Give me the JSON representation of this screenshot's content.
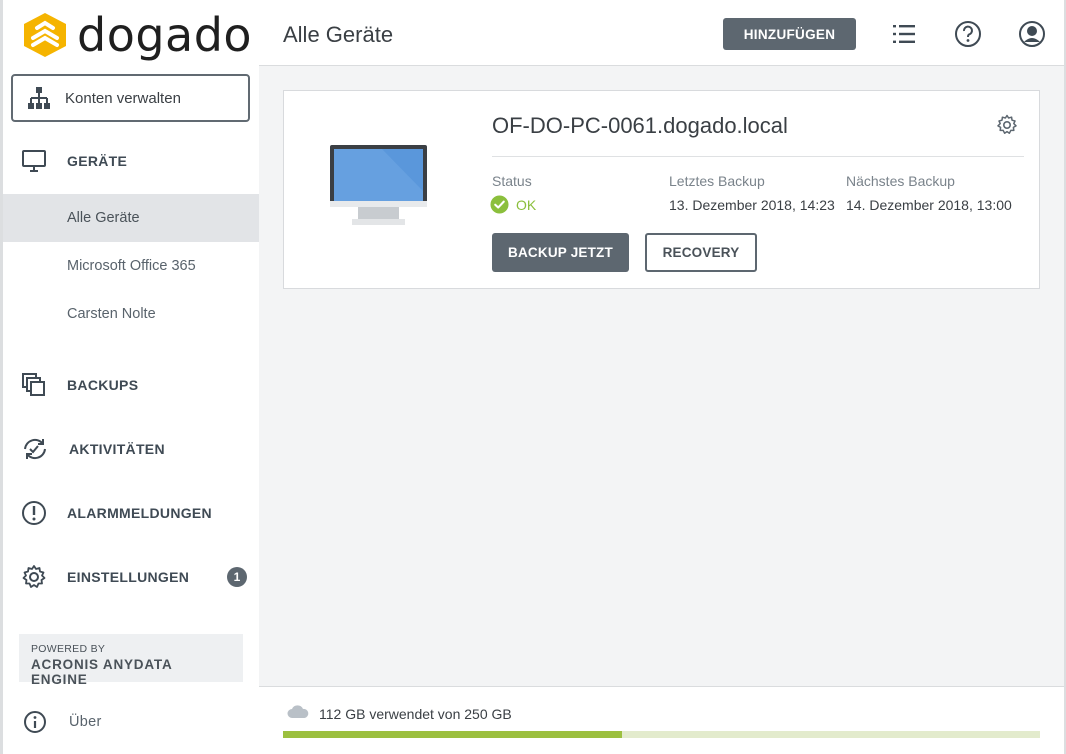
{
  "brand": {
    "name": "dogado",
    "accent": "#f5b400"
  },
  "sidebar": {
    "account_button": "Konten verwalten",
    "devices_label": "GERÄTE",
    "sub_items": [
      {
        "label": "Alle Geräte",
        "active": true
      },
      {
        "label": "Microsoft Office 365",
        "active": false
      },
      {
        "label": "Carsten Nolte",
        "active": false
      }
    ],
    "sections": [
      {
        "label": "BACKUPS",
        "icon": "backups-icon"
      },
      {
        "label": "AKTIVITÄTEN",
        "icon": "activities-icon"
      },
      {
        "label": "ALARMMELDUNGEN",
        "icon": "alert-icon"
      },
      {
        "label": "EINSTELLUNGEN",
        "icon": "gear-icon",
        "badge": "1"
      }
    ],
    "powered_by": {
      "line1": "POWERED BY",
      "line2": "ACRONIS ANYDATA ENGINE"
    },
    "about": "Über"
  },
  "header": {
    "title": "Alle Geräte",
    "add_button": "HINZUFÜGEN",
    "icons": [
      "list-icon",
      "help-icon",
      "user-icon"
    ]
  },
  "device": {
    "name": "OF-DO-PC-0061.dogado.local",
    "status_label": "Status",
    "status_value": "OK",
    "last_backup_label": "Letztes Backup",
    "last_backup_value": "13. Dezember 2018, 14:23",
    "next_backup_label": "Nächstes Backup",
    "next_backup_value": "14. Dezember 2018, 13:00",
    "backup_button": "BACKUP JETZT",
    "recovery_button": "RECOVERY"
  },
  "storage": {
    "text": "112 GB verwendet von 250 GB",
    "used_gb": 112,
    "total_gb": 250
  }
}
